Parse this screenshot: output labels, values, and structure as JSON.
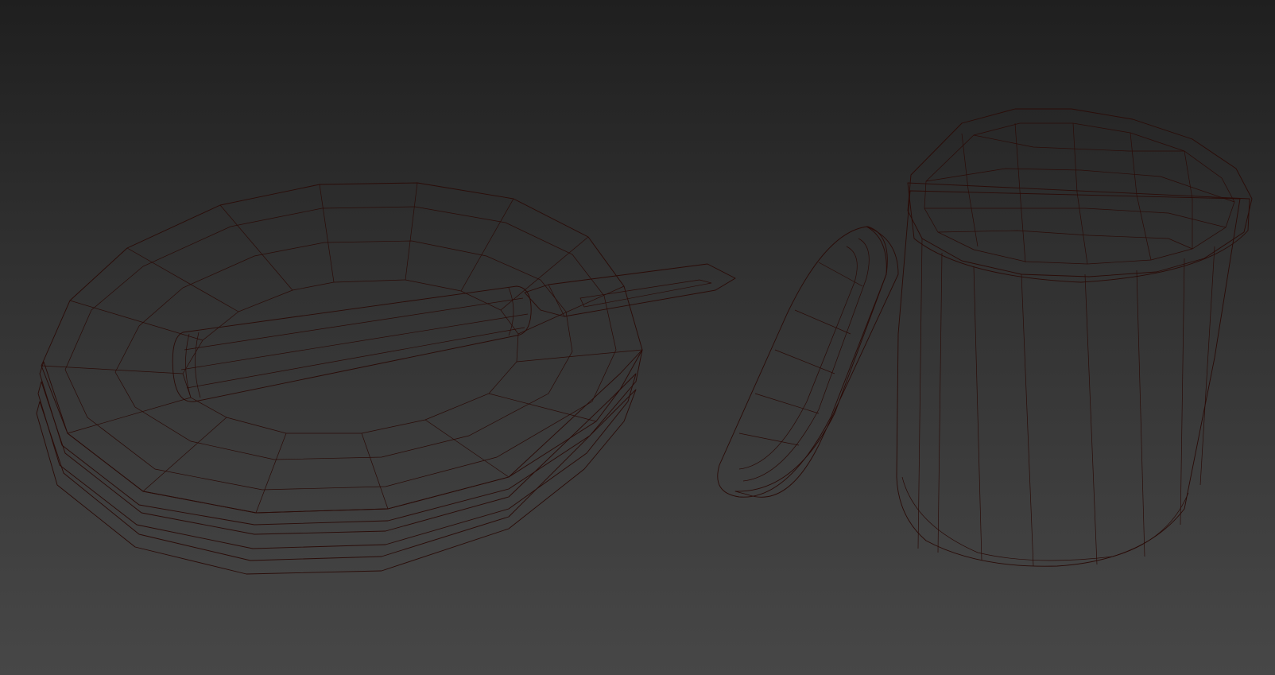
{
  "viewport": {
    "background_top": "#1f1f1f",
    "background_bottom": "#474747",
    "shading_mode": "wireframe-over-shaded"
  },
  "objects": [
    {
      "name": "plate-stack",
      "kind": "stacked plates",
      "count": 3
    },
    {
      "name": "knife",
      "kind": "knife with wooden-style handle"
    },
    {
      "name": "loose-lid",
      "kind": "jar lid, tilted"
    },
    {
      "name": "jar",
      "kind": "cylindrical jar with lid"
    }
  ],
  "colors": {
    "base": "#c9503f",
    "light": "#d56050",
    "dark": "#8e2a1f",
    "deep": "#6a1a12",
    "wire": "#2a0c08"
  }
}
